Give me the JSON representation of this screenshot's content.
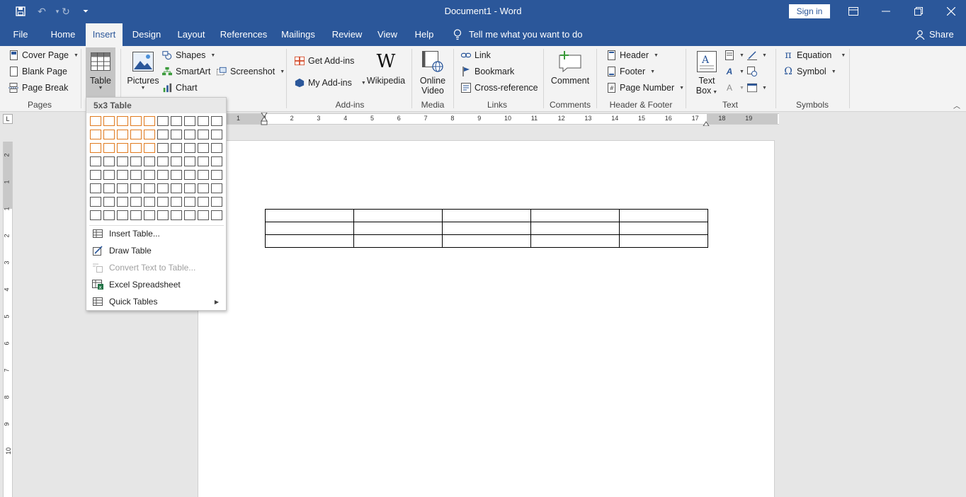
{
  "window": {
    "title": "Document1 - Word",
    "sign_in": "Sign in",
    "qa_icons": [
      "save-icon",
      "undo-icon",
      "redo-icon",
      "customize-icon"
    ]
  },
  "tabs": [
    {
      "label": "File"
    },
    {
      "label": "Home"
    },
    {
      "label": "Insert",
      "active": true
    },
    {
      "label": "Design"
    },
    {
      "label": "Layout"
    },
    {
      "label": "References"
    },
    {
      "label": "Mailings"
    },
    {
      "label": "Review"
    },
    {
      "label": "View"
    },
    {
      "label": "Help"
    }
  ],
  "tell_me": "Tell me what you want to do",
  "share": "Share",
  "ribbon": {
    "pages": {
      "label": "Pages",
      "cover_page": "Cover Page",
      "blank_page": "Blank Page",
      "page_break": "Page Break"
    },
    "tables": {
      "table": "Table"
    },
    "illustrations": {
      "pictures": "Pictures",
      "shapes": "Shapes",
      "smartart": "SmartArt",
      "chart": "Chart",
      "screenshot": "Screenshot"
    },
    "addins": {
      "label": "Add-ins",
      "get_addins": "Get Add-ins",
      "my_addins": "My Add-ins",
      "wikipedia": "Wikipedia"
    },
    "media": {
      "label": "Media",
      "online_video_1": "Online",
      "online_video_2": "Video"
    },
    "links": {
      "label": "Links",
      "link": "Link",
      "bookmark": "Bookmark",
      "cross_reference": "Cross-reference"
    },
    "comments": {
      "label": "Comments",
      "comment": "Comment"
    },
    "header_footer": {
      "label": "Header & Footer",
      "header": "Header",
      "footer": "Footer",
      "page_number": "Page Number"
    },
    "text": {
      "label": "Text",
      "text_box_1": "Text",
      "text_box_2": "Box"
    },
    "symbols": {
      "label": "Symbols",
      "equation": "Equation",
      "symbol": "Symbol"
    }
  },
  "ruler": {
    "numbers": [
      "1",
      "1",
      "2",
      "3",
      "4",
      "5",
      "6",
      "7",
      "8",
      "9",
      "10",
      "11",
      "12",
      "13",
      "14",
      "15",
      "16",
      "17",
      "18",
      "19"
    ],
    "v_numbers": [
      "2",
      "1",
      "1",
      "2",
      "3",
      "4",
      "5",
      "6",
      "7",
      "8",
      "9",
      "10"
    ]
  },
  "document": {
    "table_columns": 5,
    "table_rows": 3
  },
  "table_dropdown": {
    "header": "5x3 Table",
    "grid_cols": 10,
    "grid_rows": 8,
    "selected_cols": 5,
    "selected_rows": 3,
    "items": [
      {
        "label": "Insert Table...",
        "enabled": true,
        "icon": "insert-table-icon"
      },
      {
        "label": "Draw Table",
        "enabled": true,
        "icon": "draw-table-icon"
      },
      {
        "label": "Convert Text to Table...",
        "enabled": false,
        "icon": "convert-text-icon"
      },
      {
        "label": "Excel Spreadsheet",
        "enabled": true,
        "icon": "excel-icon"
      },
      {
        "label": "Quick Tables",
        "enabled": true,
        "icon": "quick-tables-icon",
        "submenu": true
      }
    ]
  }
}
